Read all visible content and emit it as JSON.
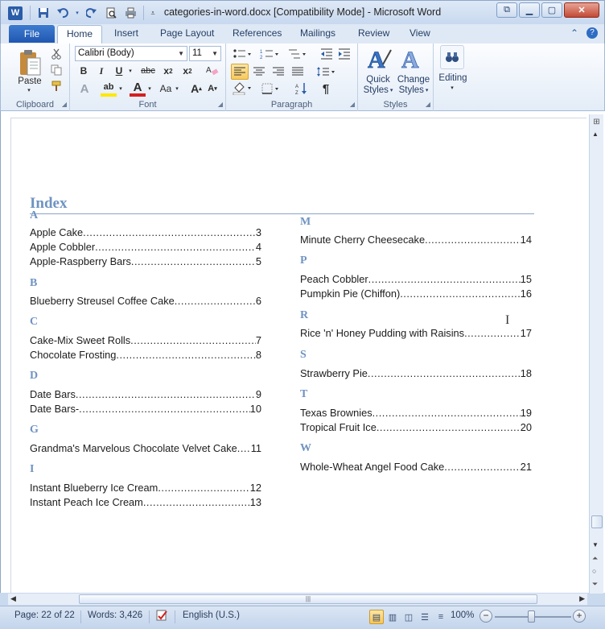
{
  "window": {
    "app_icon": "W",
    "title": "categories-in-word.docx [Compatibility Mode]  -  Microsoft Word",
    "quick_access": [
      "save-icon",
      "undo-icon",
      "redo-icon",
      "print-preview-icon",
      "quick-print-icon",
      "customize-qat-icon"
    ]
  },
  "tabs": {
    "file": "File",
    "items": [
      "Home",
      "Insert",
      "Page Layout",
      "References",
      "Mailings",
      "Review",
      "View"
    ]
  },
  "ribbon": {
    "clipboard": {
      "label": "Clipboard",
      "paste": "Paste"
    },
    "font": {
      "label": "Font",
      "font_name": "Calibri (Body)",
      "font_size": "11"
    },
    "paragraph": {
      "label": "Paragraph"
    },
    "styles": {
      "label": "Styles",
      "quick_styles_1": "Quick",
      "quick_styles_2": "Styles",
      "change_styles_1": "Change",
      "change_styles_2": "Styles"
    },
    "editing": {
      "label": "Editing"
    }
  },
  "document": {
    "heading": "Index",
    "columns": [
      [
        {
          "letter": "A",
          "entries": [
            {
              "text": "Apple Cake",
              "page": "3"
            },
            {
              "text": "Apple Cobbler ",
              "page": "4"
            },
            {
              "text": "Apple-Raspberry Bars ",
              "page": "5"
            }
          ]
        },
        {
          "letter": "B",
          "entries": [
            {
              "text": "Blueberry Streusel Coffee Cake",
              "page": "6"
            }
          ]
        },
        {
          "letter": "C",
          "entries": [
            {
              "text": "Cake-Mix Sweet Rolls",
              "page": "7"
            },
            {
              "text": "Chocolate Frosting",
              "page": "8"
            }
          ]
        },
        {
          "letter": "D",
          "entries": [
            {
              "text": "Date Bars ",
              "page": "9"
            },
            {
              "text": "Date Bars- ",
              "page": "10"
            }
          ]
        },
        {
          "letter": "G",
          "entries": [
            {
              "text": "Grandma's Marvelous Chocolate Velvet Cake",
              "page": "11"
            }
          ]
        },
        {
          "letter": "I",
          "entries": [
            {
              "text": "Instant Blueberry Ice Cream",
              "page": "12"
            },
            {
              "text": "Instant Peach Ice Cream",
              "page": "13"
            }
          ]
        }
      ],
      [
        {
          "letter": "M",
          "entries": [
            {
              "text": "Minute Cherry Cheesecake",
              "page": "14"
            }
          ]
        },
        {
          "letter": "P",
          "entries": [
            {
              "text": "Peach Cobbler",
              "page": "15"
            },
            {
              "text": "Pumpkin Pie (Chiffon)",
              "page": "16"
            }
          ]
        },
        {
          "letter": "R",
          "entries": [
            {
              "text": "Rice 'n' Honey Pudding with Raisins",
              "page": "17"
            }
          ]
        },
        {
          "letter": "S",
          "entries": [
            {
              "text": "Strawberry Pie",
              "page": "18"
            }
          ]
        },
        {
          "letter": "T",
          "entries": [
            {
              "text": "Texas Brownies",
              "page": "19"
            },
            {
              "text": "Tropical Fruit Ice ",
              "page": "20"
            }
          ]
        },
        {
          "letter": "W",
          "entries": [
            {
              "text": "Whole-Wheat Angel Food Cake",
              "page": "21"
            }
          ]
        }
      ]
    ]
  },
  "status": {
    "page": "Page: 22 of 22",
    "words": "Words: 3,426",
    "language": "English (U.S.)",
    "zoom": "100%",
    "zoom_level_percent": 100
  },
  "colors": {
    "heading": "#6f93c2",
    "file_tab": "#2a62bd",
    "highlight": "#f8c95c",
    "font_color_red": "#d42020"
  }
}
